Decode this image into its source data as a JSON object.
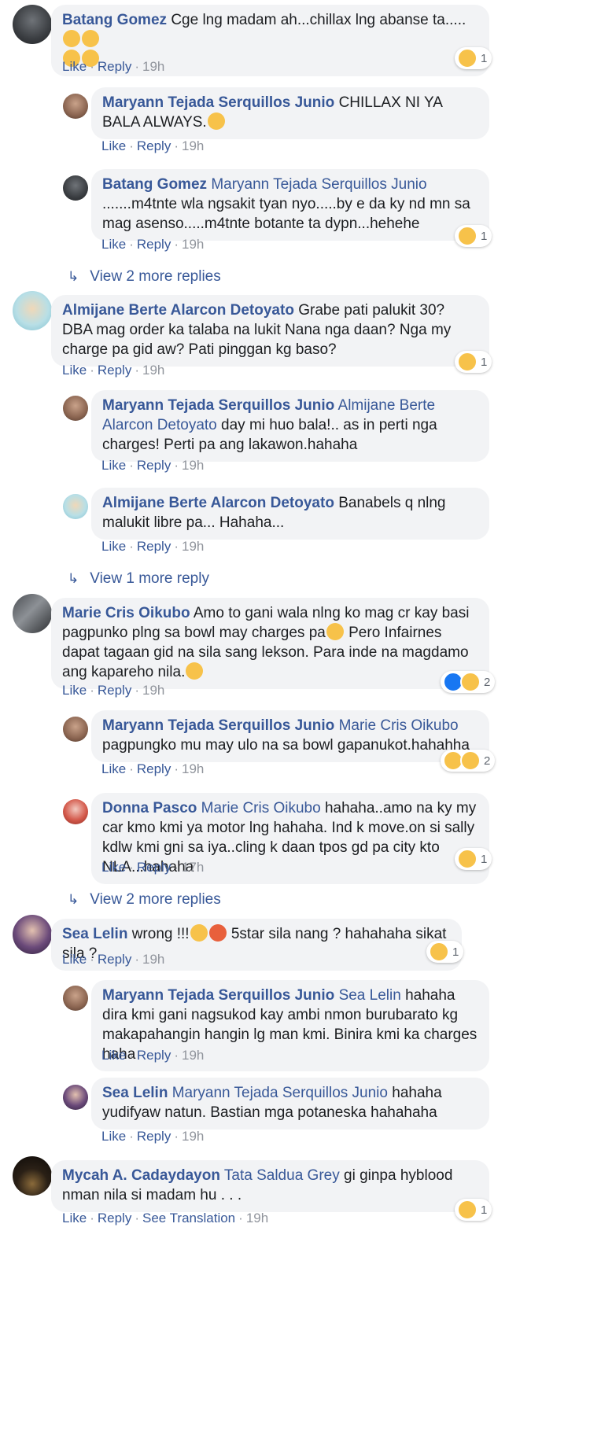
{
  "labels": {
    "like": "Like",
    "reply": "Reply",
    "see_translation": "See Translation",
    "sep": "·"
  },
  "comments": [
    {
      "author": "Batang Gomez",
      "mention": "",
      "text": "Cge lng madam ah...chillax lng abanse ta.....",
      "time": "19h",
      "reactions": "1",
      "reaction_icons": [
        "haha-icon"
      ]
    },
    {
      "author": "Maryann Tejada Serquillos Junio",
      "mention": "",
      "text": "CHILLAX NI YA BALA ALWAYS.",
      "time": "19h",
      "reactions": ""
    },
    {
      "author": "Batang Gomez",
      "mention": "Maryann Tejada Serquillos Junio",
      "text": ".......m4tnte wla ngsakit tyan nyo.....by e da ky nd mn sa mag asenso.....m4tnte botante ta dypn...hehehe",
      "time": "19h",
      "reactions": "1"
    },
    {
      "more": "View 2 more replies"
    },
    {
      "author": "Almijane Berte Alarcon Detoyato",
      "mention": "",
      "text": "Grabe pati palukit 30? DBA mag order ka talaba na lukit Nana nga daan? Nga my charge pa gid aw? Pati pinggan kg baso?",
      "time": "19h",
      "reactions": "1"
    },
    {
      "author": "Maryann Tejada Serquillos Junio",
      "mention": "Almijane Berte Alarcon Detoyato",
      "text": "day mi huo bala!.. as in perti nga charges! Perti pa ang lakawon.hahaha",
      "time": "19h",
      "reactions": ""
    },
    {
      "author": "Almijane Berte Alarcon Detoyato",
      "mention": "",
      "text": "Banabels q nlng malukit libre pa... Hahaha...",
      "time": "19h",
      "reactions": ""
    },
    {
      "more": "View 1 more reply"
    },
    {
      "author": "Marie Cris Oikubo",
      "mention": "",
      "text": "Amo to gani wala nlng ko mag cr kay basi pagpunko plng sa bowl may charges pa",
      "text2": " Pero Infairnes dapat tagaan gid na sila sang lekson. Para inde na magdamo ang kapareho nila.",
      "time": "19h",
      "reactions": "2"
    },
    {
      "author": "Maryann Tejada Serquillos Junio",
      "mention": "Marie Cris Oikubo",
      "text": "pagpungko mu may ulo na sa bowl gapanukot.hahahha",
      "time": "19h",
      "reactions": "2"
    },
    {
      "author": "Donna Pasco",
      "mention": "Marie Cris Oikubo",
      "text": "hahaha..amo na ky my car kmo kmi ya motor lng hahaha. Ind k move.on si sally kdlw kmi gni sa iya..cling k daan tpos gd pa city kto NLA...hahaha",
      "time": "17h",
      "reactions": "1"
    },
    {
      "more": "View 2 more replies"
    },
    {
      "author": "Sea Lelin",
      "mention": "",
      "text": "wrong !!!",
      "text2": " 5star sila nang ? hahahaha sikat sila ?",
      "time": "19h",
      "reactions": "1"
    },
    {
      "author": "Maryann Tejada Serquillos Junio",
      "mention": "Sea Lelin",
      "text": "hahaha dira kmi gani nagsukod kay ambi nmon burubarato kg makapahangin hangin lg man kmi. Binira kmi ka charges haha",
      "time": "19h",
      "reactions": ""
    },
    {
      "author": "Sea Lelin",
      "mention": "Maryann Tejada Serquillos Junio",
      "text": "hahaha yudifyaw natun. Bastian mga potaneska hahahaha",
      "time": "19h",
      "reactions": ""
    },
    {
      "author": "Mycah A. Cadaydayon",
      "mention": "Tata Saldua Grey",
      "text": "gi ginpa hyblood nman nila si madam hu . . .",
      "time": "19h",
      "reactions": "1"
    }
  ]
}
